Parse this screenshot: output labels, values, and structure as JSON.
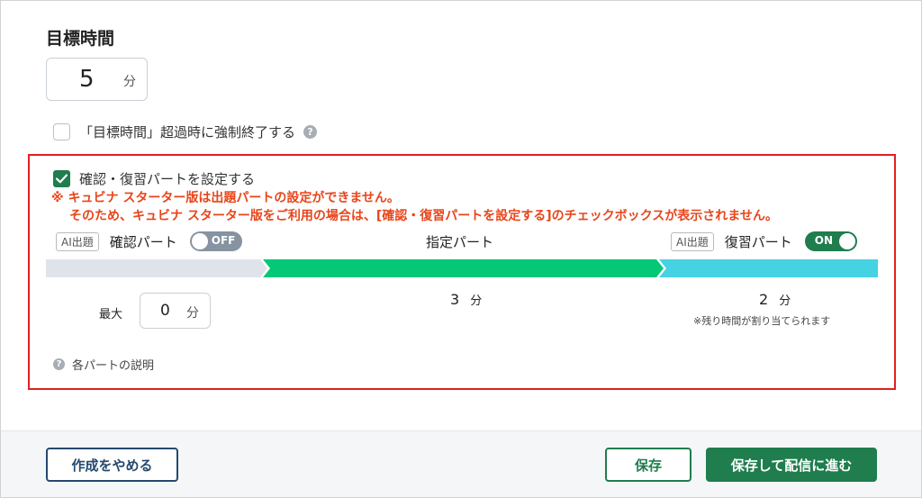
{
  "target_time": {
    "title": "目標時間",
    "minutes_value": "5",
    "minutes_unit": "分",
    "force_end_label": "「目標時間」超過時に強制終了する",
    "force_end_checked": false
  },
  "confirm_review": {
    "checkbox_label": "確認・復習パートを設定する",
    "checked": true,
    "notice_line1": "※ キュビナ スターター版は出題パートの設定ができません。",
    "notice_line2": "そのため、キュビナ スターター版をご利用の場合は、[確認・復習パートを設定する]のチェックボックスが表示されません。"
  },
  "parts": {
    "confirm": {
      "ai_badge": "AI出題",
      "label": "確認パート",
      "toggle_text": "OFF",
      "enabled": false,
      "max_label": "最大",
      "max_value": "0",
      "max_unit": "分"
    },
    "main": {
      "label": "指定パート",
      "minutes": "3",
      "unit": "分"
    },
    "review": {
      "ai_badge": "AI出題",
      "label": "復習パート",
      "toggle_text": "ON",
      "enabled": true,
      "minutes": "2",
      "unit": "分",
      "note": "※残り時間が割り当てられます"
    },
    "help_text": "各パートの説明"
  },
  "colors": {
    "accent_green": "#1f7d4e",
    "bar_confirm": "#dfe4ea",
    "bar_main": "#03c878",
    "bar_review": "#45d2e2",
    "notice_red": "#e8451a",
    "highlight_border": "#e02020",
    "navy": "#24496e"
  },
  "footer": {
    "cancel_label": "作成をやめる",
    "save_label": "保存",
    "save_deliver_label": "保存して配信に進む"
  }
}
